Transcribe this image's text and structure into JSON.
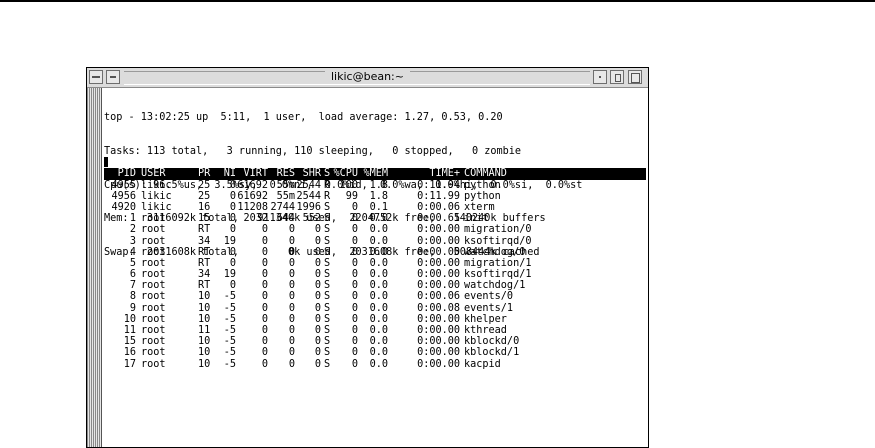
{
  "window": {
    "title": "likic@bean:~"
  },
  "summary": {
    "line1": "top - 13:02:25 up  5:11,  1 user,  load average: 1.27, 0.53, 0.20",
    "line2": "Tasks: 113 total,   3 running, 110 sleeping,   0 stopped,   0 zombie",
    "line3": "Cpu(s): 96.5%us,  3.5%sy,  0.0%ni,  0.0%id,  0.0%wa,  0.0%hi,  0.0%si,  0.0%st",
    "line4": "Mem:   3116092k total,   911340k used,  2204752k free,   140240k buffers",
    "line5": "Swap:  2031608k total,        0k used,  2031608k free,   508444k cached"
  },
  "table": {
    "columns": [
      "PID",
      "USER",
      "PR",
      "NI",
      "VIRT",
      "RES",
      "SHR",
      "S",
      "%CPU",
      "%MEM",
      "TIME+",
      "COMMAND"
    ],
    "rows": [
      [
        "4955",
        "likic",
        "25",
        "0",
        "61692",
        "55m",
        "2544",
        "R",
        "100",
        "1.8",
        "0:11.94",
        "python"
      ],
      [
        "4956",
        "likic",
        "25",
        "0",
        "61692",
        "55m",
        "2544",
        "R",
        "99",
        "1.8",
        "0:11.99",
        "python"
      ],
      [
        "4920",
        "likic",
        "16",
        "0",
        "11208",
        "2744",
        "1996",
        "S",
        "0",
        "0.1",
        "0:00.06",
        "xterm"
      ],
      [
        "1",
        "root",
        "15",
        "0",
        "2032",
        "644",
        "552",
        "S",
        "0",
        "0.0",
        "0:00.65",
        "init"
      ],
      [
        "2",
        "root",
        "RT",
        "0",
        "0",
        "0",
        "0",
        "S",
        "0",
        "0.0",
        "0:00.00",
        "migration/0"
      ],
      [
        "3",
        "root",
        "34",
        "19",
        "0",
        "0",
        "0",
        "S",
        "0",
        "0.0",
        "0:00.00",
        "ksoftirqd/0"
      ],
      [
        "4",
        "root",
        "RT",
        "0",
        "0",
        "0",
        "0",
        "S",
        "0",
        "0.0",
        "0:00.00",
        "watchdog/0"
      ],
      [
        "5",
        "root",
        "RT",
        "0",
        "0",
        "0",
        "0",
        "S",
        "0",
        "0.0",
        "0:00.00",
        "migration/1"
      ],
      [
        "6",
        "root",
        "34",
        "19",
        "0",
        "0",
        "0",
        "S",
        "0",
        "0.0",
        "0:00.00",
        "ksoftirqd/1"
      ],
      [
        "7",
        "root",
        "RT",
        "0",
        "0",
        "0",
        "0",
        "S",
        "0",
        "0.0",
        "0:00.00",
        "watchdog/1"
      ],
      [
        "8",
        "root",
        "10",
        "-5",
        "0",
        "0",
        "0",
        "S",
        "0",
        "0.0",
        "0:00.06",
        "events/0"
      ],
      [
        "9",
        "root",
        "10",
        "-5",
        "0",
        "0",
        "0",
        "S",
        "0",
        "0.0",
        "0:00.08",
        "events/1"
      ],
      [
        "10",
        "root",
        "10",
        "-5",
        "0",
        "0",
        "0",
        "S",
        "0",
        "0.0",
        "0:00.00",
        "khelper"
      ],
      [
        "11",
        "root",
        "11",
        "-5",
        "0",
        "0",
        "0",
        "S",
        "0",
        "0.0",
        "0:00.00",
        "kthread"
      ],
      [
        "15",
        "root",
        "10",
        "-5",
        "0",
        "0",
        "0",
        "S",
        "0",
        "0.0",
        "0:00.00",
        "kblockd/0"
      ],
      [
        "16",
        "root",
        "10",
        "-5",
        "0",
        "0",
        "0",
        "S",
        "0",
        "0.0",
        "0:00.00",
        "kblockd/1"
      ],
      [
        "17",
        "root",
        "10",
        "-5",
        "0",
        "0",
        "0",
        "S",
        "0",
        "0.0",
        "0:00.00",
        "kacpid"
      ]
    ]
  }
}
